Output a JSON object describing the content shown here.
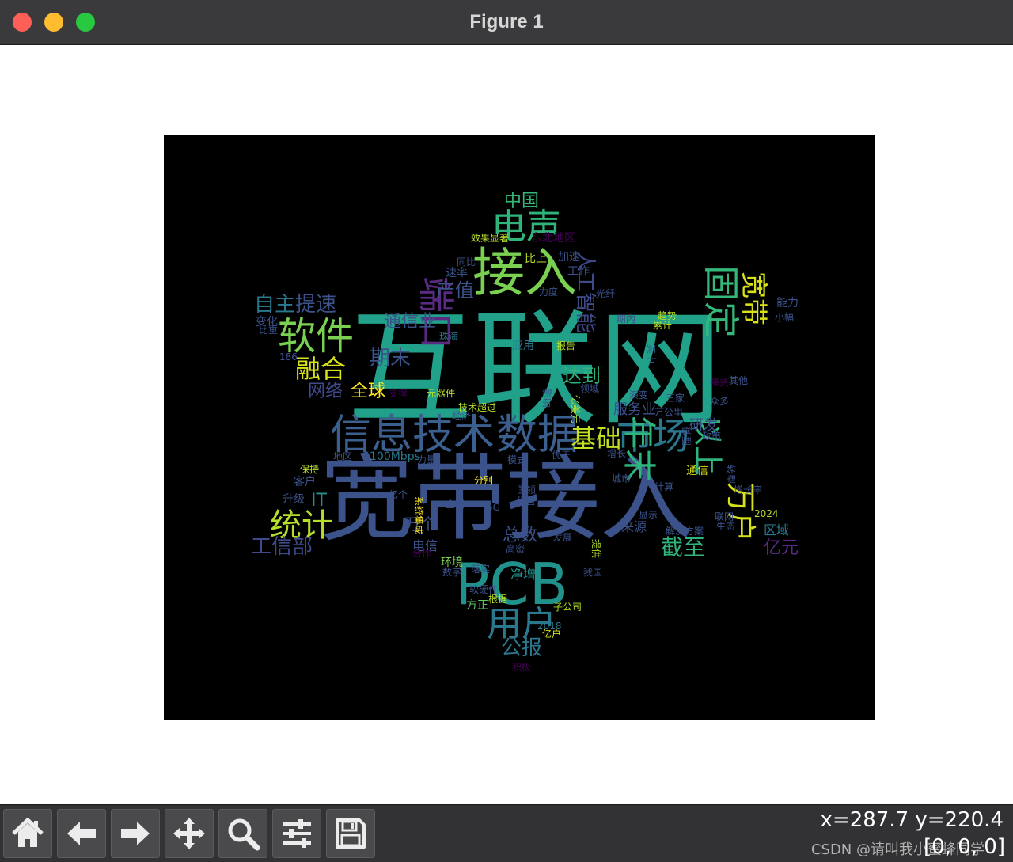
{
  "window": {
    "title": "Figure 1",
    "buttons": [
      "close",
      "minimize",
      "maximize"
    ]
  },
  "wordcloud": {
    "background": "#000000",
    "colormap": [
      "#440154",
      "#3b528b",
      "#21918c",
      "#5ec962",
      "#fde725"
    ],
    "words": [
      {
        "text": "互联网",
        "color": "#21a08a"
      },
      {
        "text": "宽带接入",
        "color": "#3b528b"
      },
      {
        "text": "信息技术",
        "color": "#3b5f8e"
      },
      {
        "text": "数据",
        "color": "#3b5f8e"
      },
      {
        "text": "接入",
        "color": "#7ad151"
      },
      {
        "text": "PCB",
        "color": "#21918c"
      },
      {
        "text": "市场",
        "color": "#2a788e"
      },
      {
        "text": "电声",
        "color": "#2fb47c"
      },
      {
        "text": "软件",
        "color": "#7ad151"
      },
      {
        "text": "固定",
        "color": "#35b779"
      },
      {
        "text": "端口",
        "color": "#5a2a82"
      },
      {
        "text": "用户",
        "color": "#2a788e"
      },
      {
        "text": "年末",
        "color": "#2fb47c"
      },
      {
        "text": "以上",
        "color": "#2fb47c"
      },
      {
        "text": "万户",
        "color": "#d8e219"
      },
      {
        "text": "宽带",
        "color": "#d8e219"
      },
      {
        "text": "人工智能",
        "color": "#3e4a89"
      },
      {
        "text": "统计",
        "color": "#b5de2b"
      },
      {
        "text": "融合",
        "color": "#d8e219"
      },
      {
        "text": "期末",
        "color": "#3b528b"
      },
      {
        "text": "基础",
        "color": "#c2df23"
      },
      {
        "text": "工信部",
        "color": "#3e4a89"
      },
      {
        "text": "截至",
        "color": "#2fb47c"
      },
      {
        "text": "亿元",
        "color": "#5a2a82"
      },
      {
        "text": "公报",
        "color": "#2a788e"
      },
      {
        "text": "自主",
        "color": "#2a788e"
      },
      {
        "text": "提速",
        "color": "#3b528b"
      },
      {
        "text": "通信业",
        "color": "#3b528b"
      },
      {
        "text": "产值",
        "color": "#3b528b"
      },
      {
        "text": "中国",
        "color": "#35b779"
      },
      {
        "text": "全球",
        "color": "#fde725"
      },
      {
        "text": "网络",
        "color": "#3e4a89"
      },
      {
        "text": "达到",
        "color": "#2fb47c"
      },
      {
        "text": "服务业",
        "color": "#3b528b"
      },
      {
        "text": "研发",
        "color": "#3b528b"
      },
      {
        "text": "总数",
        "color": "#3b528b"
      },
      {
        "text": "万个",
        "color": "#3b528b"
      },
      {
        "text": "IT",
        "color": "#21918c"
      },
      {
        "text": "区域",
        "color": "#2a788e"
      },
      {
        "text": "来源",
        "color": "#3b528b"
      },
      {
        "text": "电信",
        "color": "#3b528b"
      },
      {
        "text": "环境",
        "color": "#7ad151"
      },
      {
        "text": "净增",
        "color": "#21918c"
      },
      {
        "text": "方正",
        "color": "#5ec962"
      },
      {
        "text": "能力",
        "color": "#3b528b"
      },
      {
        "text": "应用",
        "color": "#2a788e"
      },
      {
        "text": "元器件",
        "color": "#b5de2b"
      },
      {
        "text": "客户",
        "color": "#3b528b"
      },
      {
        "text": "升级",
        "color": "#3b528b"
      },
      {
        "text": "变化",
        "color": "#3b528b"
      },
      {
        "text": "比重",
        "color": "#3b528b"
      },
      {
        "text": "速率",
        "color": "#3b528b"
      },
      {
        "text": "同比",
        "color": "#3b528b"
      },
      {
        "text": "比上",
        "color": "#b5de2b"
      },
      {
        "text": "加速",
        "color": "#3b528b"
      },
      {
        "text": "工作",
        "color": "#3b528b"
      },
      {
        "text": "力度",
        "color": "#3b528b"
      },
      {
        "text": "东北地区",
        "color": "#440154"
      },
      {
        "text": "效果显著",
        "color": "#b5de2b"
      },
      {
        "text": "通信",
        "color": "#d8e219"
      },
      {
        "text": "100Mbps",
        "color": "#2a788e"
      },
      {
        "text": "系统集成",
        "color": "#fde725"
      },
      {
        "text": "2018",
        "color": "#2a788e"
      },
      {
        "text": "2024",
        "color": "#b5de2b"
      },
      {
        "text": "186",
        "color": "#3b528b"
      },
      {
        "text": "5G",
        "color": "#3b528b"
      },
      {
        "text": "分别",
        "color": "#fde725"
      },
      {
        "text": "地区",
        "color": "#3b528b"
      },
      {
        "text": "全国",
        "color": "#3b528b"
      },
      {
        "text": "经营",
        "color": "#3b528b"
      },
      {
        "text": "数字",
        "color": "#3b528b"
      },
      {
        "text": "落实",
        "color": "#3b528b"
      },
      {
        "text": "软硬件",
        "color": "#3b528b"
      },
      {
        "text": "根据",
        "color": "#b5de2b"
      },
      {
        "text": "子公司",
        "color": "#b5de2b"
      },
      {
        "text": "亿户",
        "color": "#d8e219"
      },
      {
        "text": "积极",
        "color": "#440154"
      },
      {
        "text": "解决方案",
        "color": "#3b528b"
      },
      {
        "text": "联网",
        "color": "#3b528b"
      },
      {
        "text": "生态",
        "color": "#3b528b"
      },
      {
        "text": "增长率",
        "color": "#3b528b"
      },
      {
        "text": "发展",
        "color": "#3b528b"
      },
      {
        "text": "城市",
        "color": "#3b528b"
      },
      {
        "text": "模式",
        "color": "#3b528b"
      },
      {
        "text": "力量",
        "color": "#3b528b"
      },
      {
        "text": "保持",
        "color": "#b5de2b"
      },
      {
        "text": "计算",
        "color": "#3b528b"
      },
      {
        "text": "显示",
        "color": "#3b528b"
      },
      {
        "text": "技术超过",
        "color": "#b5de2b"
      },
      {
        "text": "经济",
        "color": "#3b528b"
      },
      {
        "text": "支撑",
        "color": "#440154"
      },
      {
        "text": "领域",
        "color": "#3b528b"
      },
      {
        "text": "报告",
        "color": "#b5de2b"
      },
      {
        "text": "期内",
        "color": "#3b528b"
      },
      {
        "text": "趋势",
        "color": "#b5de2b"
      },
      {
        "text": "累计",
        "color": "#b5de2b"
      },
      {
        "text": "其他",
        "color": "#3b528b"
      },
      {
        "text": "众多",
        "color": "#3b528b"
      },
      {
        "text": "三家",
        "color": "#3b528b"
      },
      {
        "text": "万公里",
        "color": "#3b528b"
      },
      {
        "text": "演变",
        "color": "#3b528b"
      },
      {
        "text": "小幅",
        "color": "#3b528b"
      },
      {
        "text": "降费",
        "color": "#440154"
      },
      {
        "text": "政策",
        "color": "#3b528b"
      },
      {
        "text": "转型",
        "color": "#3b528b"
      },
      {
        "text": "增长",
        "color": "#3b528b"
      },
      {
        "text": "优于",
        "color": "#3b528b"
      },
      {
        "text": "高密",
        "color": "#3b528b"
      },
      {
        "text": "我国",
        "color": "#3b528b"
      },
      {
        "text": "提供",
        "color": "#b5de2b"
      },
      {
        "text": "珠海",
        "color": "#2a788e"
      },
      {
        "text": "亿个",
        "color": "#3b528b"
      },
      {
        "text": "国领",
        "color": "#3b528b"
      },
      {
        "text": "合作",
        "color": "#440154"
      },
      {
        "text": "影响",
        "color": "#3b528b"
      },
      {
        "text": "微型",
        "color": "#3b528b"
      },
      {
        "text": "亿美元",
        "color": "#b5de2b"
      },
      {
        "text": "其中",
        "color": "#3b528b"
      },
      {
        "text": "光纤",
        "color": "#3b528b"
      }
    ]
  },
  "toolbar": {
    "icons": [
      "home-icon",
      "back-arrow-icon",
      "forward-arrow-icon",
      "move-icon",
      "zoom-icon",
      "configure-subplots-icon",
      "save-icon"
    ],
    "coords": "x=287.7 y=220.4",
    "rgb": "[0, 0, 0]",
    "watermark": "CSDN @请叫我小蜜蜂同学"
  }
}
